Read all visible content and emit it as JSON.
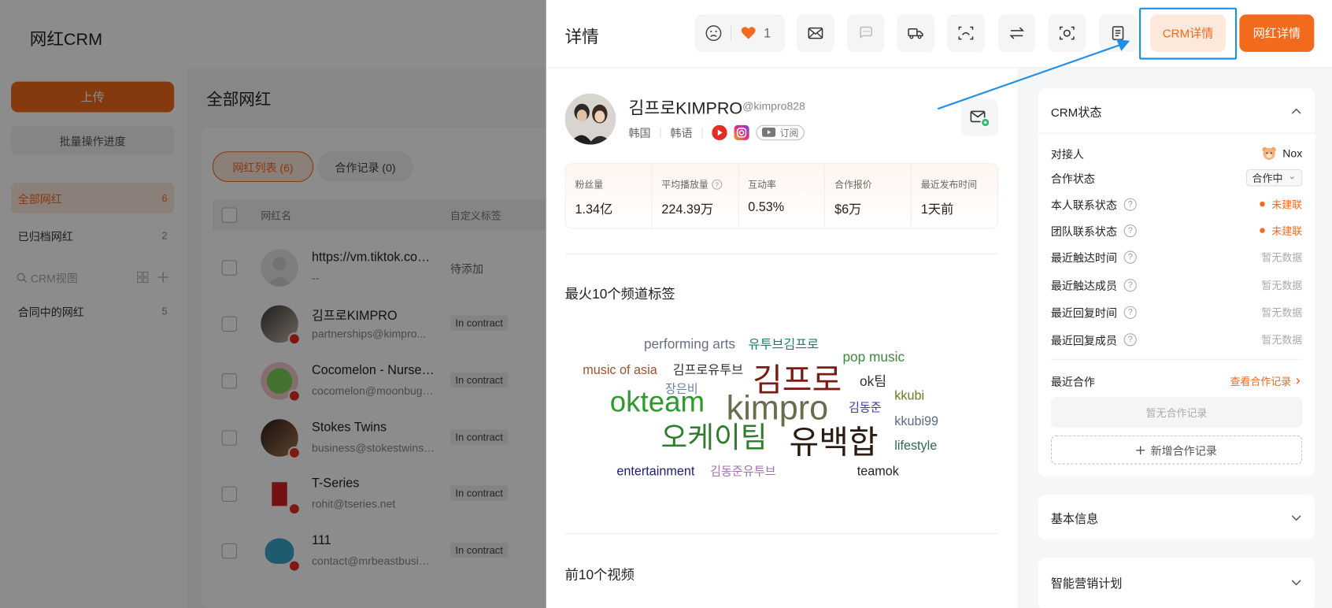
{
  "app": {
    "brand": "网红CRM"
  },
  "sidebar": {
    "upload": "上传",
    "batch": "批量操作进度",
    "items": [
      {
        "label": "全部网红",
        "count": "6"
      },
      {
        "label": "已归档网红",
        "count": "2"
      }
    ],
    "crm_view_placeholder": "CRM视图",
    "views": [
      {
        "label": "合同中的网红",
        "count": "5"
      }
    ]
  },
  "list": {
    "title": "全部网红",
    "tabs": [
      {
        "label": "网红列表 (6)"
      },
      {
        "label": "合作记录 (0)"
      }
    ],
    "columns": [
      "网红名",
      "自定义标签"
    ],
    "rows": [
      {
        "name": "https://vm.tiktok.com/...",
        "sub": "--",
        "tag": "待添加"
      },
      {
        "name": "김프로KIMPRO",
        "sub": "partnerships@kimpro...",
        "tag": "In contract"
      },
      {
        "name": "Cocomelon - Nursery Rhymes",
        "sub": "cocomelon@moonbug.com",
        "tag": "In contract"
      },
      {
        "name": "Stokes Twins",
        "sub": "business@stokestwins.com",
        "tag": "In contract"
      },
      {
        "name": "T-Series",
        "sub": "rohit@tseries.net",
        "tag": "In contract"
      },
      {
        "name": "111",
        "sub": "contact@mrbeastbusiness.com",
        "tag": "In contract"
      }
    ]
  },
  "drawer": {
    "title": "详情",
    "like_count": "1",
    "crm_detail": "CRM详情",
    "influencer_detail": "网红详情",
    "profile": {
      "name": "김프로KIMPRO",
      "handle": "@kimpro828",
      "country": "韩国",
      "language": "韩语",
      "subscribe": "订阅"
    },
    "stats": [
      {
        "label": "粉丝量",
        "value": "1.34亿"
      },
      {
        "label": "平均播放量",
        "value": "224.39万"
      },
      {
        "label": "互动率",
        "value": "0.53%"
      },
      {
        "label": "合作报价",
        "value": "$6万"
      },
      {
        "label": "最近发布时间",
        "value": "1天前"
      }
    ],
    "tags_title": "最火10个频道标签",
    "word_cloud": [
      {
        "text": "performing arts",
        "color": "#6a6f80"
      },
      {
        "text": "유투브김프로",
        "color": "#1e7e6b"
      },
      {
        "text": "pop music",
        "color": "#3b8a3b"
      },
      {
        "text": "music of asia",
        "color": "#a0522d"
      },
      {
        "text": "김프로유투브",
        "color": "#333333"
      },
      {
        "text": "김프로",
        "color": "#7a1c13"
      },
      {
        "text": "ok팀",
        "color": "#333333"
      },
      {
        "text": "장은비",
        "color": "#6b7fa8"
      },
      {
        "text": "kkubi",
        "color": "#6b7a1c"
      },
      {
        "text": "okteam",
        "color": "#2e9a2e"
      },
      {
        "text": "kimpro",
        "color": "#6b6b4e"
      },
      {
        "text": "김동준",
        "color": "#3b3bb0"
      },
      {
        "text": "kkubi99",
        "color": "#5a6a8a"
      },
      {
        "text": "오케이팀",
        "color": "#2e7d2e"
      },
      {
        "text": "유백합",
        "color": "#2a1a10"
      },
      {
        "text": "lifestyle",
        "color": "#2e6b4e"
      },
      {
        "text": "entertainment",
        "color": "#1c1c7a"
      },
      {
        "text": "김동준유투브",
        "color": "#a070b0"
      },
      {
        "text": "teamok",
        "color": "#222222"
      }
    ],
    "videos_title": "前10个视频"
  },
  "crm": {
    "status_title": "CRM状态",
    "fields": [
      {
        "label": "对接人",
        "value": "Nox"
      },
      {
        "label": "合作状态",
        "value": "合作中"
      },
      {
        "label": "本人联系状态",
        "value": "未建联"
      },
      {
        "label": "团队联系状态",
        "value": "未建联"
      },
      {
        "label": "最近触达时间",
        "value": "暂无数据"
      },
      {
        "label": "最近触达成员",
        "value": "暂无数据"
      },
      {
        "label": "最近回复时间",
        "value": "暂无数据"
      },
      {
        "label": "最近回复成员",
        "value": "暂无数据"
      }
    ],
    "recent_coop": "最近合作",
    "view_records": "查看合作记录",
    "no_records": "暂无合作记录",
    "add_record": "新增合作记录",
    "basic_info": "基本信息",
    "marketing_plan": "智能营销计划"
  },
  "colors": {
    "accent": "#f26a1b",
    "highlight": "#1e8fe6"
  }
}
